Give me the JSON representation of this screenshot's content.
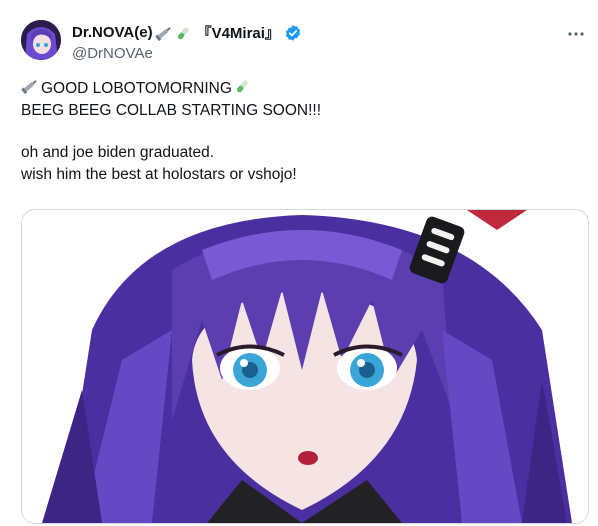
{
  "tweet": {
    "author": {
      "display_name": "Dr.NOVA(e)",
      "display_suffix": "『V4Mirai』",
      "handle": "@DrNOVAe",
      "avatar_icon": "purple-haired-avatar",
      "verified": true,
      "verified_color": "#1d9bf0"
    },
    "more_icon": "more-dots-icon",
    "text_lines": [
      "GOOD LOBOTOMORNING",
      "BEEG BEEG COLLAB STARTING SOON!!!",
      "oh and joe biden graduated.",
      "wish him the best at holostars or vshojo!"
    ],
    "emoji": [
      "syringe-emoji",
      "test-tube-emoji"
    ],
    "media": {
      "kind": "image",
      "description_icon": "anime-character-art"
    }
  },
  "colors": {
    "text": "#0f1419",
    "secondary_text": "#536471",
    "hair": "#5b3fb0",
    "border": "#cfd9de"
  }
}
